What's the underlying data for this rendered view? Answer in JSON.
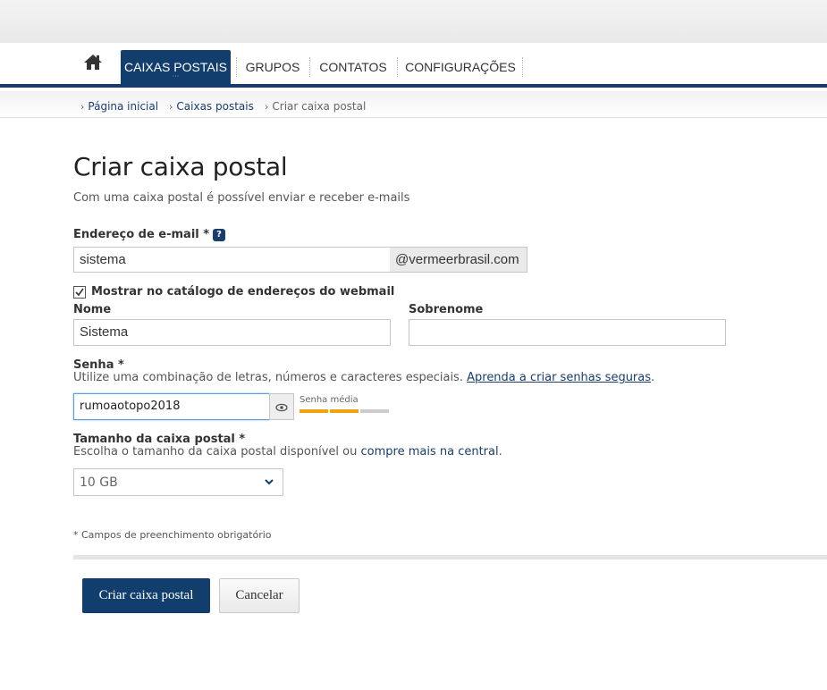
{
  "nav": {
    "home_icon": "home-icon",
    "items": [
      {
        "label": "CAIXAS POSTAIS",
        "active": true
      },
      {
        "label": "GRUPOS",
        "active": false
      },
      {
        "label": "CONTATOS",
        "active": false
      },
      {
        "label": "CONFIGURAÇÕES",
        "active": false
      }
    ],
    "accent": "#123e6e"
  },
  "breadcrumb": [
    {
      "label": "Página inicial"
    },
    {
      "label": "Caixas postais"
    },
    {
      "label": "Criar caixa postal"
    }
  ],
  "page": {
    "title": "Criar caixa postal",
    "subtitle": "Com uma caixa postal é possível enviar e receber e-mails"
  },
  "form": {
    "email": {
      "label": "Endereço de e-mail *",
      "help": "?",
      "value": "sistema",
      "domain": "@vermeerbrasil.com"
    },
    "show_in_catalog": {
      "label": "Mostrar no catálogo de endereços do webmail",
      "checked": true,
      "check_mark": "☑"
    },
    "first_name": {
      "label": "Nome",
      "value": "Sistema"
    },
    "last_name": {
      "label": "Sobrenome",
      "value": ""
    },
    "password": {
      "label": "Senha *",
      "hint": "Utilize uma combinação de letras, números e caracteres especiais.",
      "hint_link": "Aprenda a criar senhas seguras",
      "hint_end": ".",
      "value": "rumoaotopo2018",
      "strength_label": "Senha média",
      "strength_level": 2,
      "strength_max": 3,
      "strength_color": "#f0a30a",
      "strength_empty_color": "#cccccc",
      "reveal_icon": "eye-icon"
    },
    "mailbox_size": {
      "label": "Tamanho da caixa postal *",
      "hint": "Escolha o tamanho da caixa postal disponível ou",
      "hint_link": "compre mais na central",
      "hint_end": ".",
      "selected": "10 GB"
    },
    "required_note": "* Campos de preenchimento obrigatório"
  },
  "actions": {
    "submit": "Criar caixa postal",
    "cancel": "Cancelar"
  }
}
